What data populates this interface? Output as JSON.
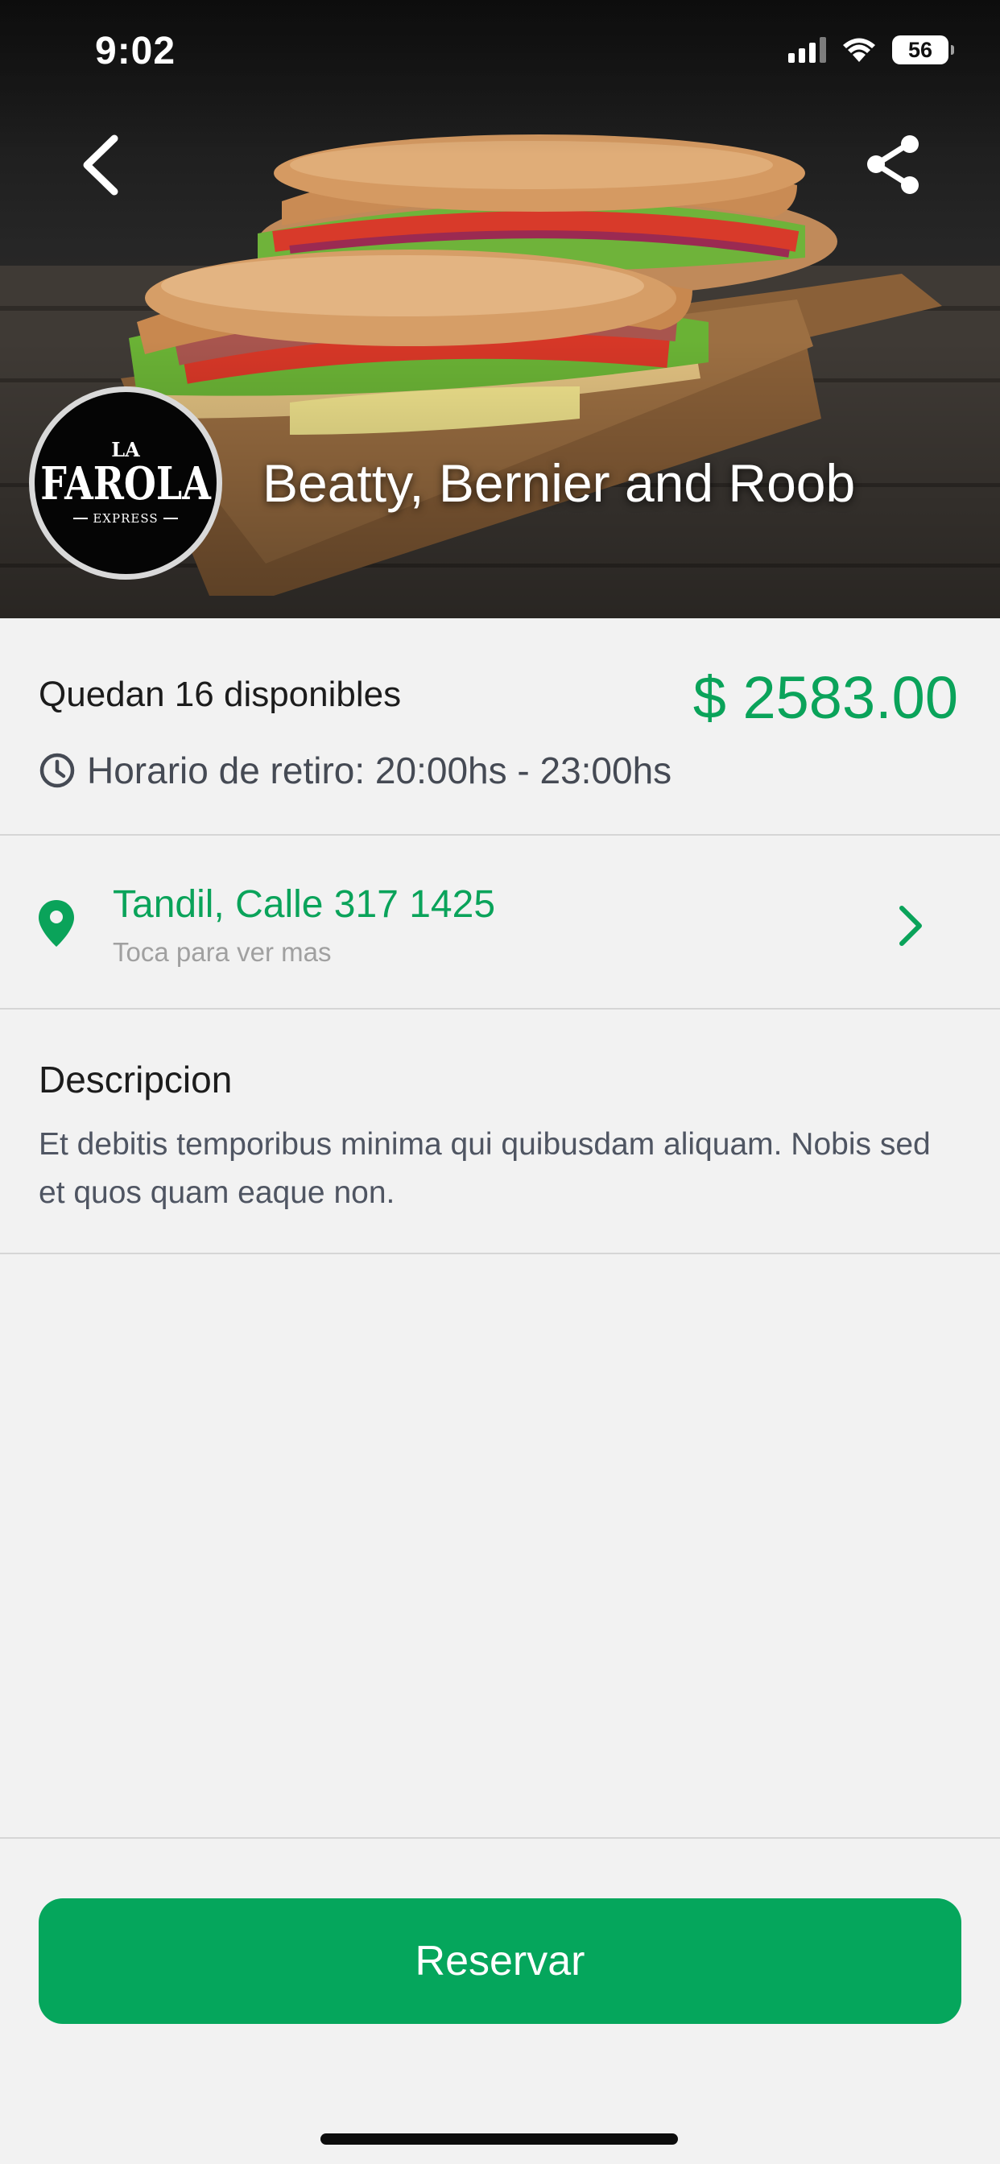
{
  "status_bar": {
    "time": "9:02",
    "battery_level": "56",
    "icons": [
      "signal-icon",
      "wifi-icon",
      "battery-icon"
    ]
  },
  "header": {
    "back_icon": "chevron-left-icon",
    "share_icon": "share-icon",
    "logo": {
      "line1": "LA",
      "line2": "FAROLA",
      "line3": "EXPRESS"
    },
    "store_name": "Beatty, Bernier and Roob"
  },
  "info": {
    "availability": "Quedan 16 disponibles",
    "price": "$ 2583.00",
    "pickup_icon": "clock-icon",
    "pickup_hours": "Horario de retiro: 20:00hs - 23:00hs"
  },
  "location": {
    "icon": "map-pin-icon",
    "address": "Tandil, Calle 317 1425",
    "hint": "Toca para ver mas",
    "chevron_icon": "chevron-right-icon"
  },
  "description": {
    "title": "Descripcion",
    "text": "Et debitis temporibus minima qui quibusdam aliquam. Nobis sed et quos quam eaque non."
  },
  "footer": {
    "reserve_label": "Reservar"
  },
  "colors": {
    "accent": "#05a65c",
    "price": "#0aa35a",
    "background": "#f2f2f2",
    "muted_text": "#4f5562"
  }
}
